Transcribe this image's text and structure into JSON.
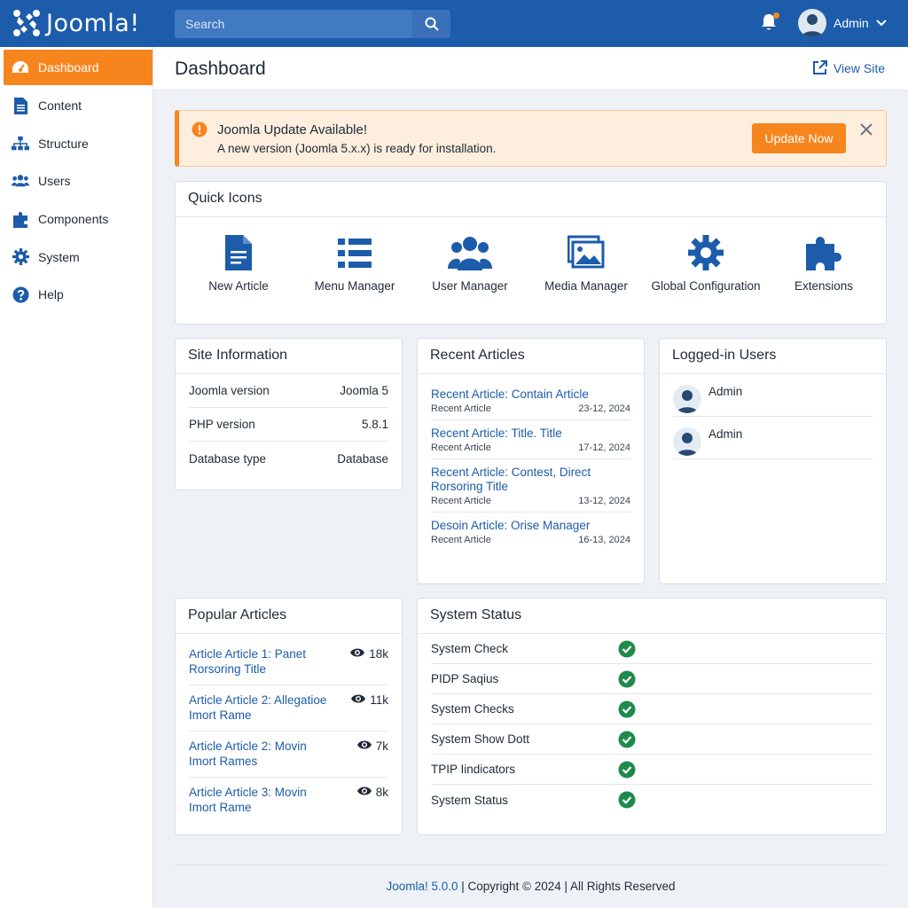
{
  "header": {
    "logo_text": "Joomla!",
    "search_placeholder": "Search",
    "user_name": "Admin"
  },
  "sidebar": {
    "items": [
      {
        "label": "Dashboard",
        "icon": "speedometer-icon",
        "active": true
      },
      {
        "label": "Content",
        "icon": "file-icon"
      },
      {
        "label": "Structure",
        "icon": "sitemap-icon"
      },
      {
        "label": "Users",
        "icon": "users-icon"
      },
      {
        "label": "Components",
        "icon": "cubes-icon"
      },
      {
        "label": "System",
        "icon": "gear-icon"
      },
      {
        "label": "Help",
        "icon": "question-icon"
      }
    ]
  },
  "titlebar": {
    "title": "Dashboard",
    "view_site": "View Site"
  },
  "alert": {
    "title": "Joomla Update Available!",
    "text": "A new version (Joomla 5.x.x) is ready for installation.",
    "button": "Update Now"
  },
  "quick_icons": {
    "title": "Quick Icons",
    "items": [
      {
        "label": "New Article",
        "icon": "article-icon"
      },
      {
        "label": "Menu Manager",
        "icon": "list-icon"
      },
      {
        "label": "User Manager",
        "icon": "users-icon"
      },
      {
        "label": "Media Manager",
        "icon": "images-icon"
      },
      {
        "label": "Global Configuration",
        "icon": "gear-icon"
      },
      {
        "label": "Extensions",
        "icon": "puzzle-icon"
      }
    ]
  },
  "site_info": {
    "title": "Site Information",
    "rows": [
      {
        "label": "Joomla version",
        "value": "Joomla 5"
      },
      {
        "label": "PHP version",
        "value": "5.8.1"
      },
      {
        "label": "Database type",
        "value": "Database"
      }
    ]
  },
  "recent_articles": {
    "title": "Recent Articles",
    "items": [
      {
        "title": "Recent Article: Contain Article",
        "meta": "Recent Article",
        "date": "23-12, 2024"
      },
      {
        "title": "Recent Article: Title. Title",
        "meta": "Recent Article",
        "date": "17-12, 2024"
      },
      {
        "title": "Recent Article: Contest, Direct Rorsoring Title",
        "meta": "Recent Article",
        "date": "13-12, 2024"
      },
      {
        "title": "Desoin Article: Orise Manager",
        "meta": "Recent Article",
        "date": "16-13, 2024"
      }
    ]
  },
  "logged_users": {
    "title": "Logged-in Users",
    "users": [
      {
        "name": "Admin"
      },
      {
        "name": "Admin"
      }
    ]
  },
  "popular_articles": {
    "title": "Popular Articles",
    "items": [
      {
        "title": "Article Article 1: Panet Rorsoring Title",
        "views": "18k"
      },
      {
        "title": "Article Article 2: Allegatioe Imort Rame",
        "views": "11k"
      },
      {
        "title": "Article Article 2: Movin Imort Rames",
        "views": "7k"
      },
      {
        "title": "Article Article 3: Movin Imort Rame",
        "views": "8k"
      }
    ]
  },
  "system_status": {
    "title": "System Status",
    "items": [
      {
        "label": "System Check"
      },
      {
        "label": "PIDP Saqius"
      },
      {
        "label": "System Checks"
      },
      {
        "label": "System Show Dott"
      },
      {
        "label": "TPIP Iindicators"
      },
      {
        "label": "System Status"
      }
    ]
  },
  "footer": {
    "version": "Joomla! 5.0.0",
    "copyright": " | Copyright © 2024 | All Rights Reserved"
  },
  "colors": {
    "header": "#1c5caa",
    "accent": "#f7851e",
    "success": "#1e8a4c"
  }
}
